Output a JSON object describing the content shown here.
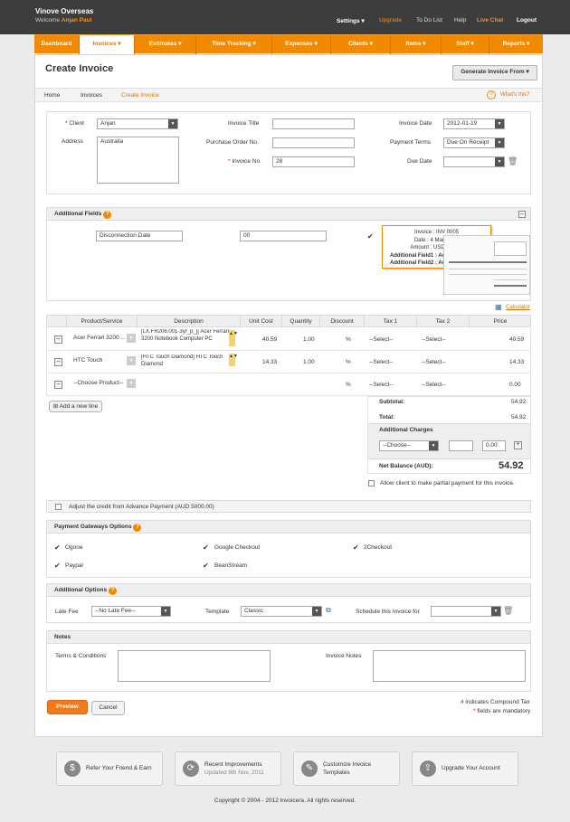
{
  "topbar": {
    "company": "Vinove Overseas",
    "welcome": "Welcome",
    "user": "Anjan Paul",
    "links": [
      "Settings ▾",
      "Upgrade",
      "To Do List",
      "Help",
      "Live Chat",
      "Logout"
    ]
  },
  "nav": [
    "Dashboard",
    "Invoices ▾",
    "Estimates ▾",
    "Time Tracking ▾",
    "Expenses ▾",
    "Clients ▾",
    "Items ▾",
    "Staff ▾",
    "Reports ▾"
  ],
  "page": {
    "title": "Create Invoice",
    "generate": "Generate Invoice From",
    "crumbs": [
      "Home",
      "Invoices",
      "Create Invoice"
    ],
    "whats_this": "What's this?"
  },
  "form": {
    "client_label": "Client",
    "client_value": "Anjan",
    "address_label": "Address",
    "address_value": "Australia",
    "title_label": "Invoice Title",
    "po_label": "Purchase Order No.",
    "invno_label": "Invoice No.",
    "invno_value": "28",
    "date_label": "Invoice Date",
    "date_value": "2012-01-19",
    "terms_label": "Payment Terms",
    "terms_value": "Due On Receipt",
    "due_label": "Due Date"
  },
  "additional_fields": {
    "title": "Additional Fields",
    "field1": "Disconnection Date",
    "field2": "00",
    "tooltip": [
      "Invoice : INV 0005",
      "Date : 4 Mar, 2010",
      "Amount : USD 750.00",
      "Additional Field1 : Additional value1",
      "Additional Field2 : Additional value2"
    ],
    "calculator": "Calculator"
  },
  "table": {
    "headers": [
      "Product/Service",
      "Description",
      "Unit Cost",
      "Quantity",
      "Discount",
      "Tax 1",
      "Tax 2",
      "Price"
    ],
    "rows": [
      {
        "product": "Acer Ferrari 3200 ...",
        "desc": "[LX.FR206.001-3yr_p_][ Acer Ferrari 3200 Notebook Computer PC",
        "unit": "40.59",
        "qty": "1.00",
        "disc": "%",
        "tax1": "--Select--",
        "tax2": "--Select--",
        "price": "40.59"
      },
      {
        "product": "HTC Touch",
        "desc": "[HTC Touch Diamond] HTC Touch Diamond",
        "unit": "14.33",
        "qty": "1.00",
        "disc": "%",
        "tax1": "--Select--",
        "tax2": "--Select--",
        "price": "14.33"
      },
      {
        "product": "--Choose Product--",
        "desc": "",
        "unit": "",
        "qty": "",
        "disc": "%",
        "tax1": "--Select--",
        "tax2": "--Select--",
        "price": "0.00"
      }
    ],
    "add_line": "Add a new line"
  },
  "totals": {
    "subtotal_label": "Subtotal:",
    "subtotal": "54.92",
    "total_label": "Total:",
    "total": "54.92",
    "charges_label": "Additional Charges",
    "choose": "--Choose--",
    "charge_value": "0.00",
    "net_label": "Net Balance (AUD):",
    "net": "54.92",
    "partial": "Allow client to make partial payment for this invoice."
  },
  "credit": "Adjust the credit from Advance Payment (AUD 5000.00)",
  "gateways": {
    "title": "Payment Gateways Options",
    "items": [
      "Ogone",
      "Google Checkout",
      "2Checkout",
      "Paypal",
      "BeanStream"
    ]
  },
  "options": {
    "title": "Additional Options",
    "late_label": "Late Fee",
    "late_value": "--No Late Fee--",
    "template_label": "Template",
    "template_value": "Classic",
    "schedule_label": "Schedule this Invoice for"
  },
  "notes": {
    "title": "Notes",
    "terms_label": "Terms & Conditions",
    "notes_label": "Invoice Notes"
  },
  "buttons": {
    "preview": "Preview",
    "cancel": "Cancel"
  },
  "legend": {
    "compound": "# indicates Compound Tax",
    "mandatory": "fields are mandatory"
  },
  "footer": {
    "cards": [
      {
        "t1": "Refer Your Friend & Earn",
        "t2": ""
      },
      {
        "t1": "Recent Improvements",
        "t2": "Updated 9th Nov, 2011"
      },
      {
        "t1": "Customize Invoice",
        "t2": "Templates"
      },
      {
        "t1": "Upgrade Your Account",
        "t2": ""
      }
    ],
    "copyright": "Copyright © 2004 - 2012 Invoicera. All rights reserved."
  },
  "colors": {
    "accent": "#f28a00",
    "topbar": "#3d3d3d"
  }
}
